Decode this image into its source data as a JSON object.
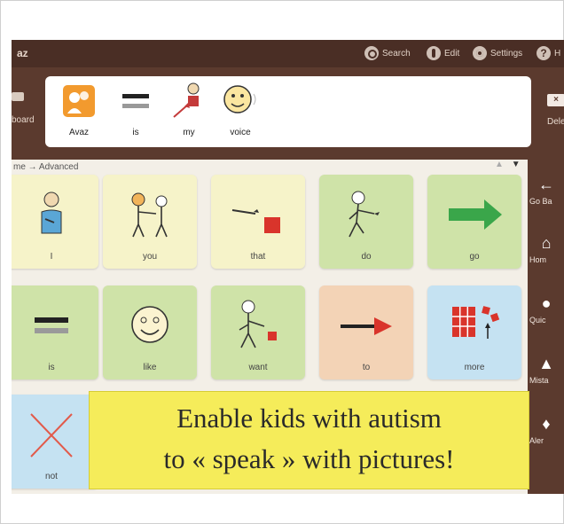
{
  "app": {
    "title": "az"
  },
  "toolbar": {
    "search_label": "Search",
    "edit_label": "Edit",
    "settings_label": "Settings",
    "help_label": "H"
  },
  "sentence": {
    "keyboard_label": "board",
    "words": [
      {
        "label": "Avaz",
        "icon": "avaz-logo-icon"
      },
      {
        "label": "is",
        "icon": "equals-icon"
      },
      {
        "label": "my",
        "icon": "my-person-icon"
      },
      {
        "label": "voice",
        "icon": "talking-face-icon"
      }
    ],
    "delete_label": "Dele"
  },
  "breadcrumb": {
    "text": "me → Advanced"
  },
  "scroll": {
    "up": "▲",
    "down": "▼"
  },
  "sidebar": {
    "items": [
      {
        "label": "Go Ba",
        "icon": "back-arrow-icon"
      },
      {
        "label": "Hom",
        "icon": "home-icon"
      },
      {
        "label": "Quic",
        "icon": "quick-icon"
      },
      {
        "label": "Mista",
        "icon": "warning-icon"
      },
      {
        "label": "Aler",
        "icon": "bell-icon"
      }
    ]
  },
  "grid": {
    "row1": [
      {
        "label": "I",
        "color": "yellow"
      },
      {
        "label": "you",
        "color": "yellow"
      },
      {
        "label": "that",
        "color": "yellow"
      },
      {
        "label": "do",
        "color": "green"
      },
      {
        "label": "go",
        "color": "green"
      }
    ],
    "row2": [
      {
        "label": "is",
        "color": "green"
      },
      {
        "label": "like",
        "color": "green"
      },
      {
        "label": "want",
        "color": "green"
      },
      {
        "label": "to",
        "color": "peach"
      },
      {
        "label": "more",
        "color": "blue"
      }
    ],
    "row3": [
      {
        "label": "not",
        "color": "blue"
      }
    ]
  },
  "caption": {
    "line1": "Enable kids with autism",
    "line2": "to « speak » with pictures!"
  },
  "colors": {
    "topbar": "#4a2e25",
    "sentence_bar": "#5b3a2e",
    "tile_yellow": "#f6f3c9",
    "tile_green": "#cfe3a8",
    "tile_peach": "#f3d3b6",
    "tile_blue": "#c5e2f2",
    "caption_bg": "#f5ec5a"
  }
}
